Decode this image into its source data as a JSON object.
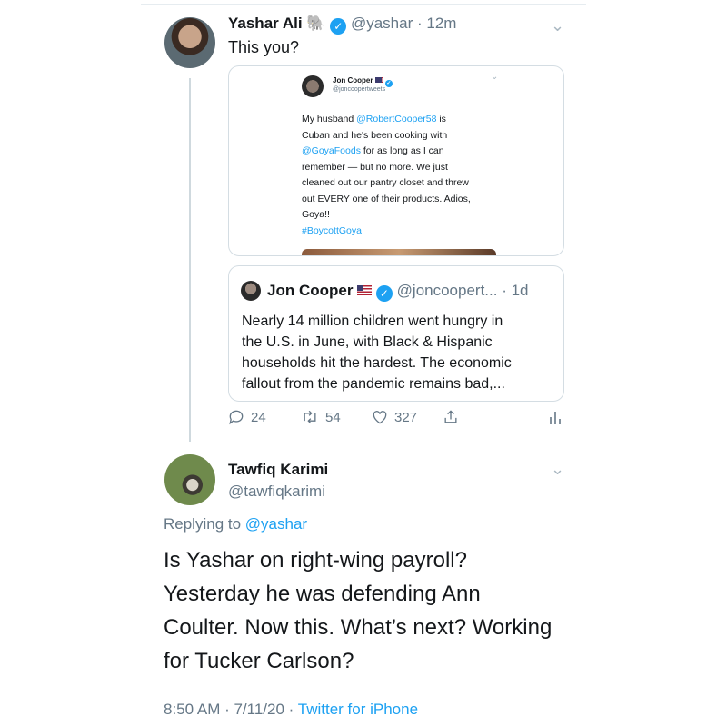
{
  "tweet": {
    "display_name": "Yashar Ali",
    "name_emoji": "🐘",
    "handle": "@yashar",
    "time": "12m",
    "text": "This you?",
    "screenshot": {
      "display_name": "Jon Cooper",
      "handle": "@joncoopertweets",
      "line1_mention": "@RobertCooper58",
      "line1_pre": "My husband ",
      "line1_post": " is",
      "line2": "Cuban and he's been cooking with",
      "line3_mention": "@GoyaFoods",
      "line3_post": " for as long as I can",
      "line4": "remember — but no more. We just",
      "line5": "cleaned out our pantry closet and threw",
      "line6": "out EVERY one of their products. Adios,",
      "line7": "Goya!!",
      "hashtag": "#BoycottGoya"
    },
    "quoted": {
      "display_name": "Jon Cooper",
      "handle": "@joncoopert...",
      "time": "· 1d",
      "line1": "Nearly 14 million children went hungry in",
      "line2": "the U.S. in June, with Black & Hispanic",
      "line3": "households hit the hardest. The economic",
      "line4": "fallout from the pandemic remains bad,..."
    },
    "actions": {
      "replies": "24",
      "retweets": "54",
      "likes": "327"
    }
  },
  "reply": {
    "display_name": "Tawfiq Karimi",
    "handle": "@tawfiqkarimi",
    "replying_prefix": "Replying to ",
    "replying_to": "@yashar",
    "line1": "Is Yashar on right-wing payroll?",
    "line2": "Yesterday he was defending Ann",
    "line3": "Coulter. Now this. What’s next? Working",
    "line4": "for Tucker Carlson?",
    "timestamp": "8:50 AM · 7/11/20 · ",
    "source": "Twitter for iPhone"
  },
  "colors": {
    "accent": "#1da1f2",
    "muted": "#657786",
    "border": "#d4dde3"
  }
}
